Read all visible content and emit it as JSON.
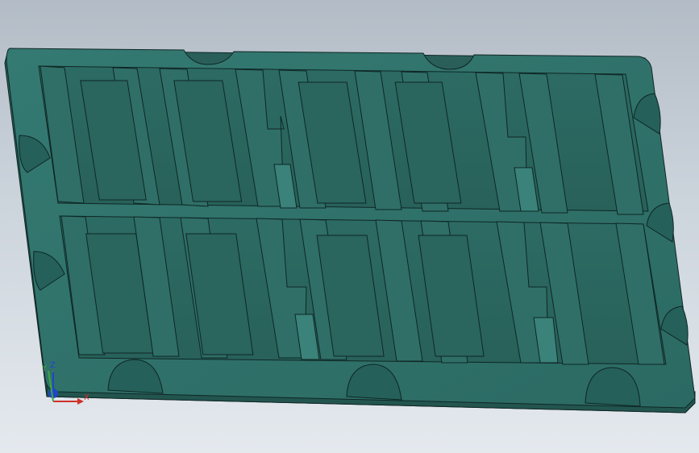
{
  "viewport": {
    "background_top": "#b3bcc6",
    "background_bottom": "#e4e9ee",
    "model_color": "#2f6f68",
    "model_edge_color": "#0f2624"
  },
  "triad": {
    "x_label": "X",
    "y_label": "Y",
    "z_label": "Z",
    "x_color": "#d0302a",
    "y_color": "#3ea83a",
    "z_color": "#1f46c8"
  }
}
